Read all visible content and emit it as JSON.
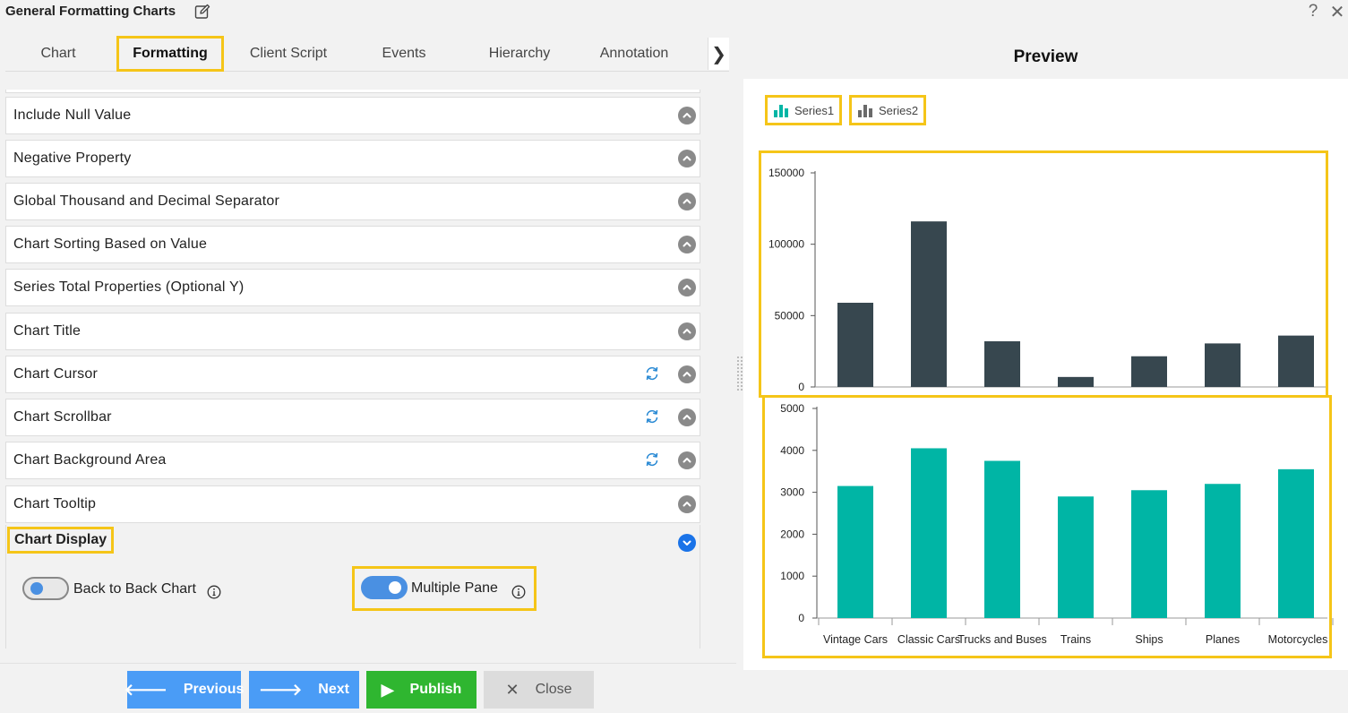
{
  "window": {
    "title": "General Formatting Charts",
    "help_glyph": "?",
    "close_glyph": "✕"
  },
  "tabs": [
    {
      "label": "Chart",
      "active": false
    },
    {
      "label": "Formatting",
      "active": true
    },
    {
      "label": "Client Script",
      "active": false
    },
    {
      "label": "Events",
      "active": false
    },
    {
      "label": "Hierarchy",
      "active": false
    },
    {
      "label": "Annotation",
      "active": false
    }
  ],
  "tabs_more_glyph": "❯",
  "accordion": [
    {
      "label": "Include Null Value",
      "refresh": false
    },
    {
      "label": "Negative Property",
      "refresh": false
    },
    {
      "label": "Global Thousand and Decimal Separator",
      "refresh": false
    },
    {
      "label": "Chart Sorting Based on Value",
      "refresh": false
    },
    {
      "label": "Series Total Properties (Optional Y)",
      "refresh": false
    },
    {
      "label": "Chart Title",
      "refresh": false
    },
    {
      "label": "Chart Cursor",
      "refresh": true
    },
    {
      "label": "Chart Scrollbar",
      "refresh": true
    },
    {
      "label": "Chart Background Area",
      "refresh": true
    },
    {
      "label": "Chart Tooltip",
      "refresh": false
    }
  ],
  "chart_display": {
    "label": "Chart Display",
    "back_to_back": {
      "label": "Back to Back Chart",
      "on": false
    },
    "multiple_pane": {
      "label": "Multiple Pane",
      "on": true
    }
  },
  "buttons": {
    "previous": "Previous",
    "next": "Next",
    "publish": "Publish",
    "close": "Close"
  },
  "preview": {
    "title": "Preview",
    "legend": [
      {
        "name": "Series1",
        "color": "#00b5a5"
      },
      {
        "name": "Series2",
        "color": "#37474f"
      }
    ]
  },
  "colors": {
    "highlight": "#f5c518",
    "series1": "#00b5a5",
    "series2": "#37474f",
    "primary_button": "#4a9cf6",
    "publish_button": "#2fb630"
  },
  "chart_data": {
    "type": "bar",
    "categories": [
      "Vintage Cars",
      "Classic Cars",
      "Trucks and Buses",
      "Trains",
      "Ships",
      "Planes",
      "Motorcycles"
    ],
    "panes": [
      {
        "series": [
          {
            "name": "Series2",
            "values": [
              59000,
              116000,
              32000,
              7000,
              21500,
              30500,
              36000
            ]
          }
        ],
        "ylim": [
          0,
          150000
        ],
        "yticks": [
          0,
          50000,
          100000,
          150000
        ]
      },
      {
        "series": [
          {
            "name": "Series1",
            "values": [
              3150,
              4050,
              3750,
              2900,
              3050,
              3200,
              3550
            ]
          }
        ],
        "ylim": [
          0,
          5000
        ],
        "yticks": [
          0,
          1000,
          2000,
          3000,
          4000,
          5000
        ]
      }
    ],
    "grid": false
  }
}
